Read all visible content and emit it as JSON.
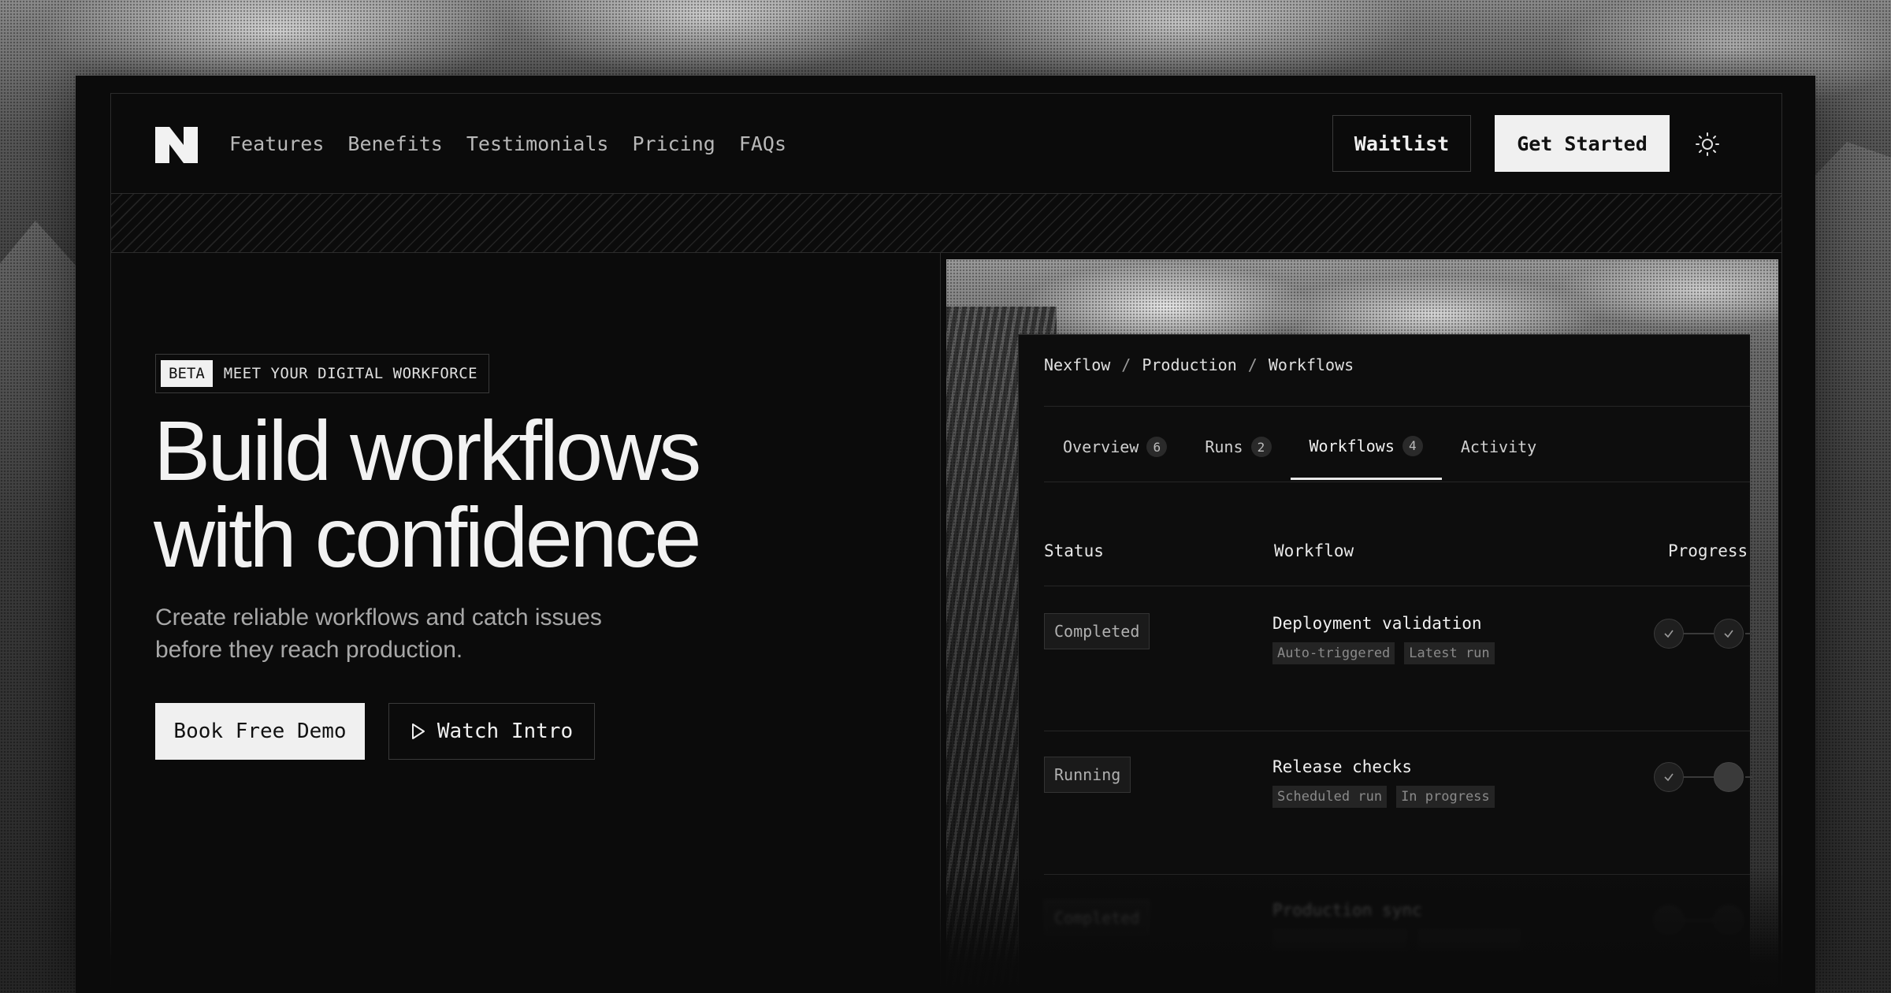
{
  "nav": {
    "links": [
      "Features",
      "Benefits",
      "Testimonials",
      "Pricing",
      "FAQs"
    ],
    "waitlist_label": "Waitlist",
    "get_started_label": "Get Started",
    "theme_icon": "sun-icon"
  },
  "hero": {
    "badge_tag": "BETA",
    "badge_text": "MEET YOUR DIGITAL WORKFORCE",
    "title_line1": "Build workflows",
    "title_line2": "with confidence",
    "subtitle_line1": "Create reliable workflows and catch issues",
    "subtitle_line2": "before they reach production.",
    "demo_label": "Book Free Demo",
    "intro_label": "Watch Intro",
    "intro_icon": "play-icon"
  },
  "app": {
    "breadcrumb": [
      "Nexflow",
      "Production",
      "Workflows"
    ],
    "breadcrumb_sep": "/",
    "tabs": [
      {
        "label": "Overview",
        "count": "6"
      },
      {
        "label": "Runs",
        "count": "2"
      },
      {
        "label": "Workflows",
        "count": "4"
      },
      {
        "label": "Activity",
        "count": ""
      }
    ],
    "active_tab": "Workflows",
    "columns": [
      "Status",
      "Workflow",
      "Progress"
    ],
    "rows": [
      {
        "status": "Completed",
        "name": "Deployment validation",
        "tags": [
          "Auto-triggered",
          "Latest run"
        ],
        "progress_steps_done": 2,
        "progress_steps_total": 2
      },
      {
        "status": "Running",
        "name": "Release checks",
        "tags": [
          "Scheduled run",
          "In progress"
        ],
        "progress_steps_done": 1,
        "progress_steps_total": 2
      },
      {
        "status": "Completed",
        "name": "Production sync",
        "tags": [
          "",
          ""
        ],
        "progress_steps_done": 2,
        "progress_steps_total": 2
      }
    ]
  },
  "colors": {
    "background": "#0b0b0b",
    "primary_button": "#f0f0f0",
    "border": "#2c2c2c",
    "text": "#f2f2f2",
    "muted_text": "#a8a8a8"
  }
}
